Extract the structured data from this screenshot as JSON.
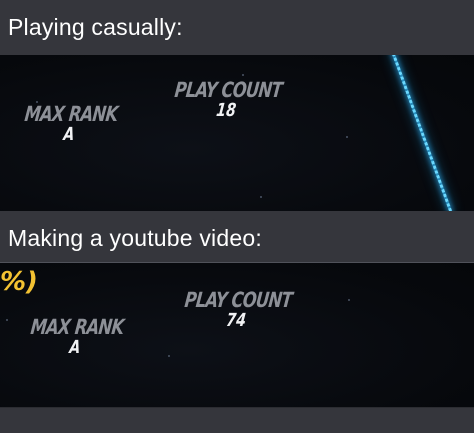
{
  "captions": {
    "first": "Playing casually:",
    "second": "Making a youtube video:"
  },
  "panel_casual": {
    "max_rank_label": "MAX RANK",
    "max_rank_value": "A",
    "play_count_label": "PLAY COUNT",
    "play_count_value": "18"
  },
  "panel_youtube": {
    "partial_percent_text": "%)",
    "max_rank_label": "MAX RANK",
    "max_rank_value": "A",
    "play_count_label": "PLAY COUNT",
    "play_count_value": "74"
  },
  "colors": {
    "page_background": "#35363c",
    "panel_background": "#07090d",
    "laser": "#3cc4ff",
    "percent_text": "#f3c232"
  }
}
